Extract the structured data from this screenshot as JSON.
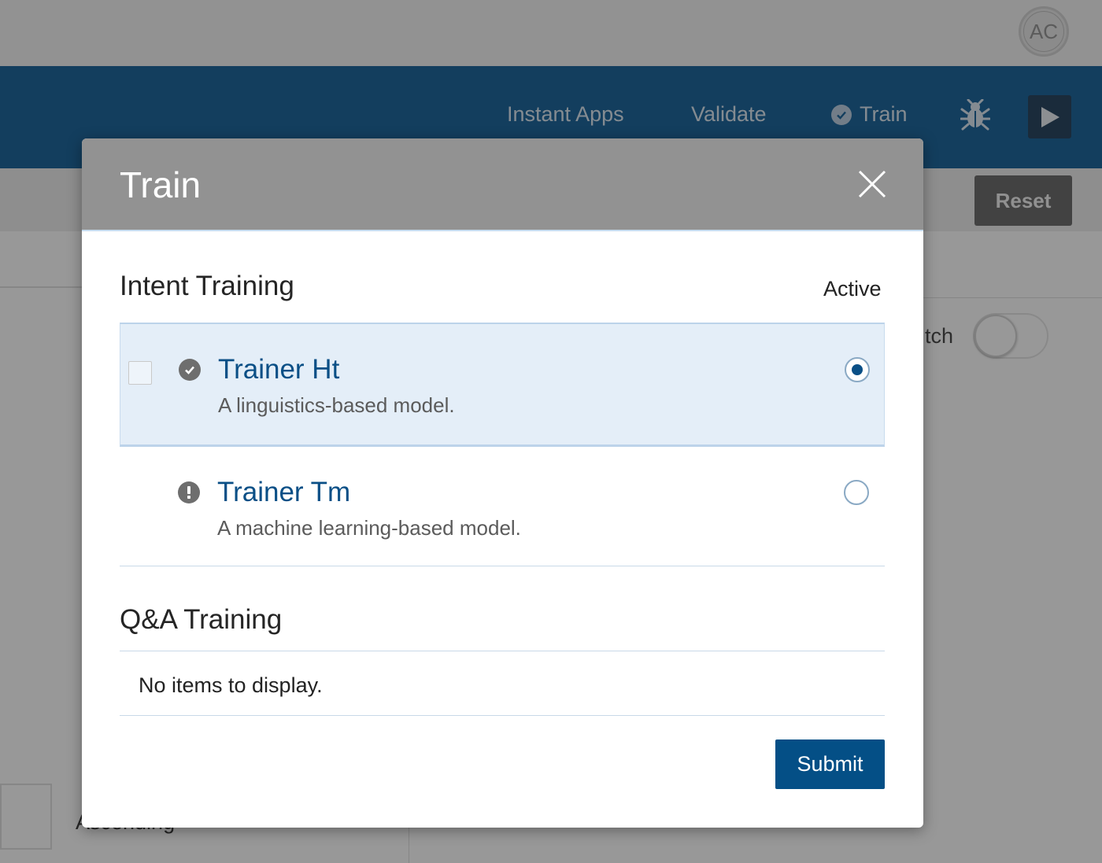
{
  "header": {
    "avatar_initials": "AC"
  },
  "nav": {
    "items": [
      {
        "label": "Instant Apps"
      },
      {
        "label": "Validate"
      },
      {
        "label": "Train",
        "icon": "check-circle-icon"
      }
    ],
    "bug_icon": "bug-icon",
    "play_icon": "play-icon"
  },
  "subbar": {
    "reset_label": "Reset"
  },
  "background": {
    "match_label": "tch",
    "sort_label": "Ascending"
  },
  "modal": {
    "title": "Train",
    "close_icon": "close-icon",
    "intent": {
      "title": "Intent Training",
      "active_label": "Active",
      "trainers": [
        {
          "name": "Trainer Ht",
          "description": "A linguistics-based model.",
          "status_icon": "check-circle-icon",
          "selected": true,
          "highlighted": true
        },
        {
          "name": "Trainer Tm",
          "description": "A machine learning-based model.",
          "status_icon": "exclamation-circle-icon",
          "selected": false,
          "highlighted": false
        }
      ]
    },
    "qa": {
      "title": "Q&A Training",
      "empty_text": "No items to display."
    },
    "submit_label": "Submit"
  },
  "colors": {
    "nav_bg": "#015491",
    "primary": "#044f86",
    "link": "#0a4f86",
    "selected_row_bg": "#e4eef8",
    "modal_header_bg": "#929292"
  }
}
